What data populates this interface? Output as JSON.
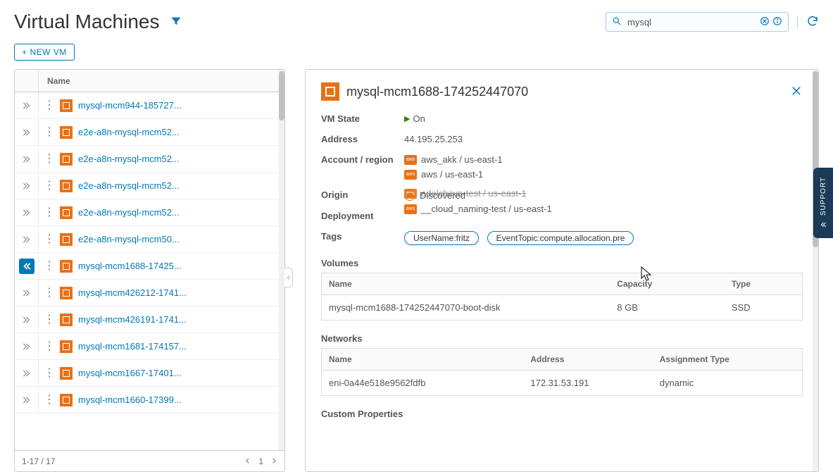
{
  "page_title": "Virtual Machines",
  "new_vm_label": "NEW VM",
  "search": {
    "value": "mysql",
    "placeholder": ""
  },
  "list": {
    "header_name": "Name",
    "footer_range": "1-17 / 17",
    "page_num": "1",
    "rows": [
      {
        "name": "mysql-mcm944-185727...",
        "selected": false
      },
      {
        "name": "e2e-a8n-mysql-mcm52...",
        "selected": false
      },
      {
        "name": "e2e-a8n-mysql-mcm52...",
        "selected": false
      },
      {
        "name": "e2e-a8n-mysql-mcm52...",
        "selected": false
      },
      {
        "name": "e2e-a8n-mysql-mcm52...",
        "selected": false
      },
      {
        "name": "e2e-a8n-mysql-mcm50...",
        "selected": false
      },
      {
        "name": "mysql-mcm1688-17425...",
        "selected": true
      },
      {
        "name": "mysql-mcm426212-1741...",
        "selected": false
      },
      {
        "name": "mysql-mcm426191-1741...",
        "selected": false
      },
      {
        "name": "mysql-mcm1681-174157...",
        "selected": false
      },
      {
        "name": "mysql-mcm1667-17401...",
        "selected": false
      },
      {
        "name": "mysql-mcm1660-17399...",
        "selected": false
      }
    ]
  },
  "detail": {
    "title": "mysql-mcm1688-174252447070",
    "labels": {
      "vm_state": "VM State",
      "address": "Address",
      "account_region": "Account / region",
      "origin": "Origin",
      "deployment": "Deployment",
      "tags": "Tags",
      "volumes": "Volumes",
      "networks": "Networks",
      "custom_props": "Custom Properties"
    },
    "vm_state": "On",
    "address": "44.195.25.253",
    "accounts": [
      "aws_akk / us-east-1",
      "aws / us-east-1",
      "adelcheva-test / us-east-1",
      "__cloud_naming-test / us-east-1"
    ],
    "origin": "Discovered",
    "tags": [
      "UserName:fritz",
      "EventTopic:compute.allocation.pre"
    ],
    "volumes": {
      "headers": {
        "name": "Name",
        "capacity": "Capacity",
        "type": "Type"
      },
      "rows": [
        {
          "name": "mysql-mcm1688-174252447070-boot-disk",
          "capacity": "8 GB",
          "type": "SSD"
        }
      ]
    },
    "networks": {
      "headers": {
        "name": "Name",
        "address": "Address",
        "atype": "Assignment Type"
      },
      "rows": [
        {
          "name": "eni-0a44e518e9562fdfb",
          "address": "172.31.53.191",
          "atype": "dynamic"
        }
      ]
    }
  },
  "support_label": "SUPPORT"
}
